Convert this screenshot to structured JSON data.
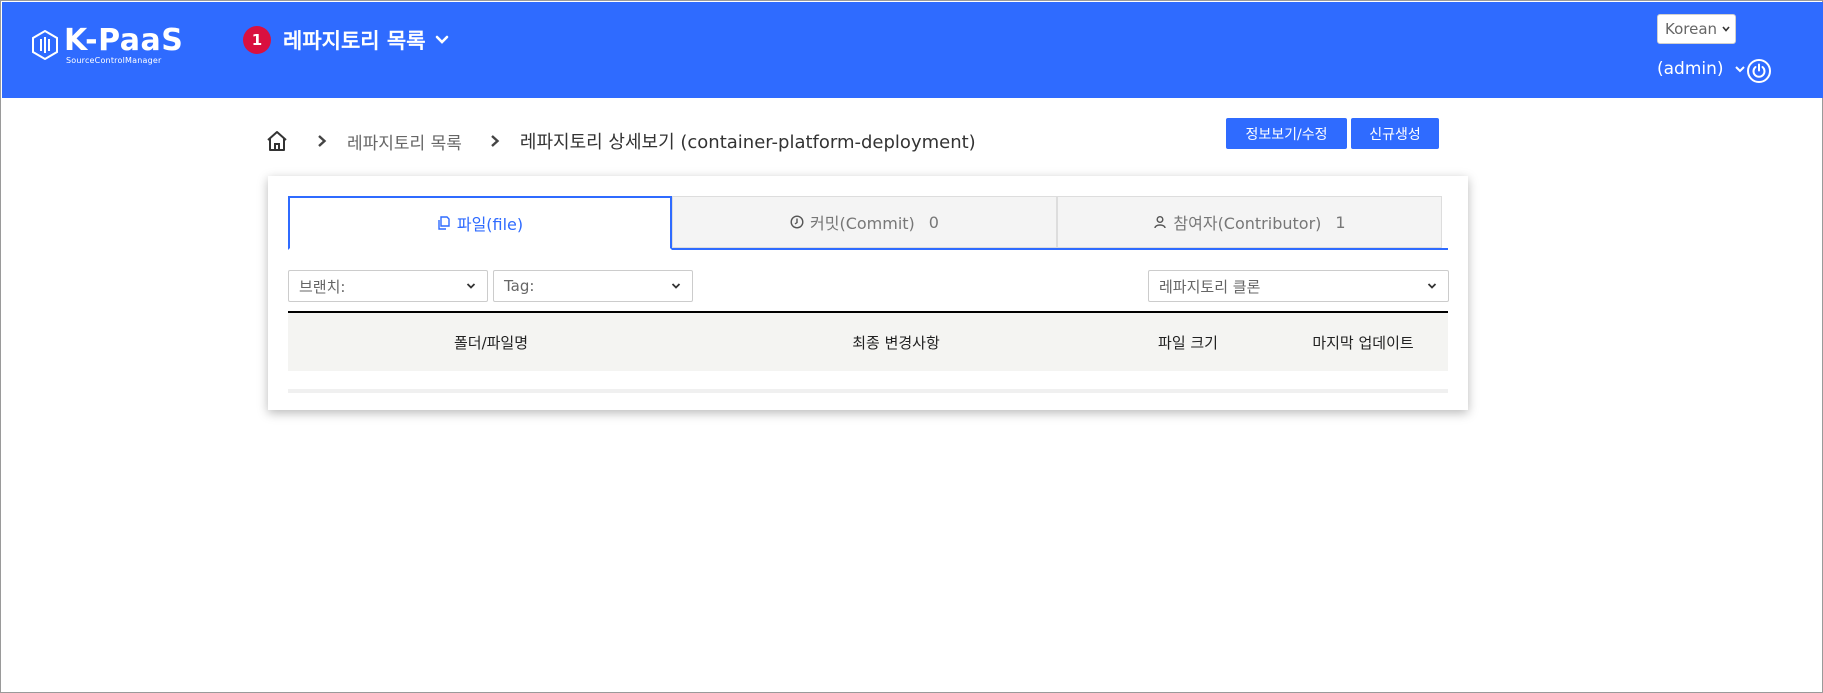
{
  "header": {
    "logo_title": "K-PaaS",
    "logo_subtitle": "SourceControlManager",
    "project_count": "1",
    "project_title": "레파지토리 목록",
    "language": "Korean",
    "user": "(admin)",
    "icons": [
      "logo-icon",
      "chevron-down-icon",
      "power-icon"
    ]
  },
  "breadcrumb": {
    "home_icon": "home-icon",
    "items": [
      "레파지토리 목록",
      "레파지토리 상세보기 (container-platform-deployment)"
    ]
  },
  "actions": {
    "info_edit": "정보보기/수정",
    "create_new": "신규생성"
  },
  "tabs": [
    {
      "label": "파일(file)",
      "count": "",
      "icon": "file-copy-icon",
      "active": true
    },
    {
      "label": "커밋(Commit)",
      "count": "0",
      "icon": "clock-icon",
      "active": false
    },
    {
      "label": "참여자(Contributor)",
      "count": "1",
      "icon": "user-icon",
      "active": false
    }
  ],
  "filters": {
    "branch": "브랜치:",
    "tag": "Tag:",
    "clone": "레파지토리 클론"
  },
  "table": {
    "columns": [
      "폴더/파일명",
      "최종 변경사항",
      "파일 크기",
      "마지막 업데이트"
    ],
    "rows": []
  },
  "colors": {
    "brand_blue": "#2f6bff",
    "badge_red": "#d9103f"
  }
}
